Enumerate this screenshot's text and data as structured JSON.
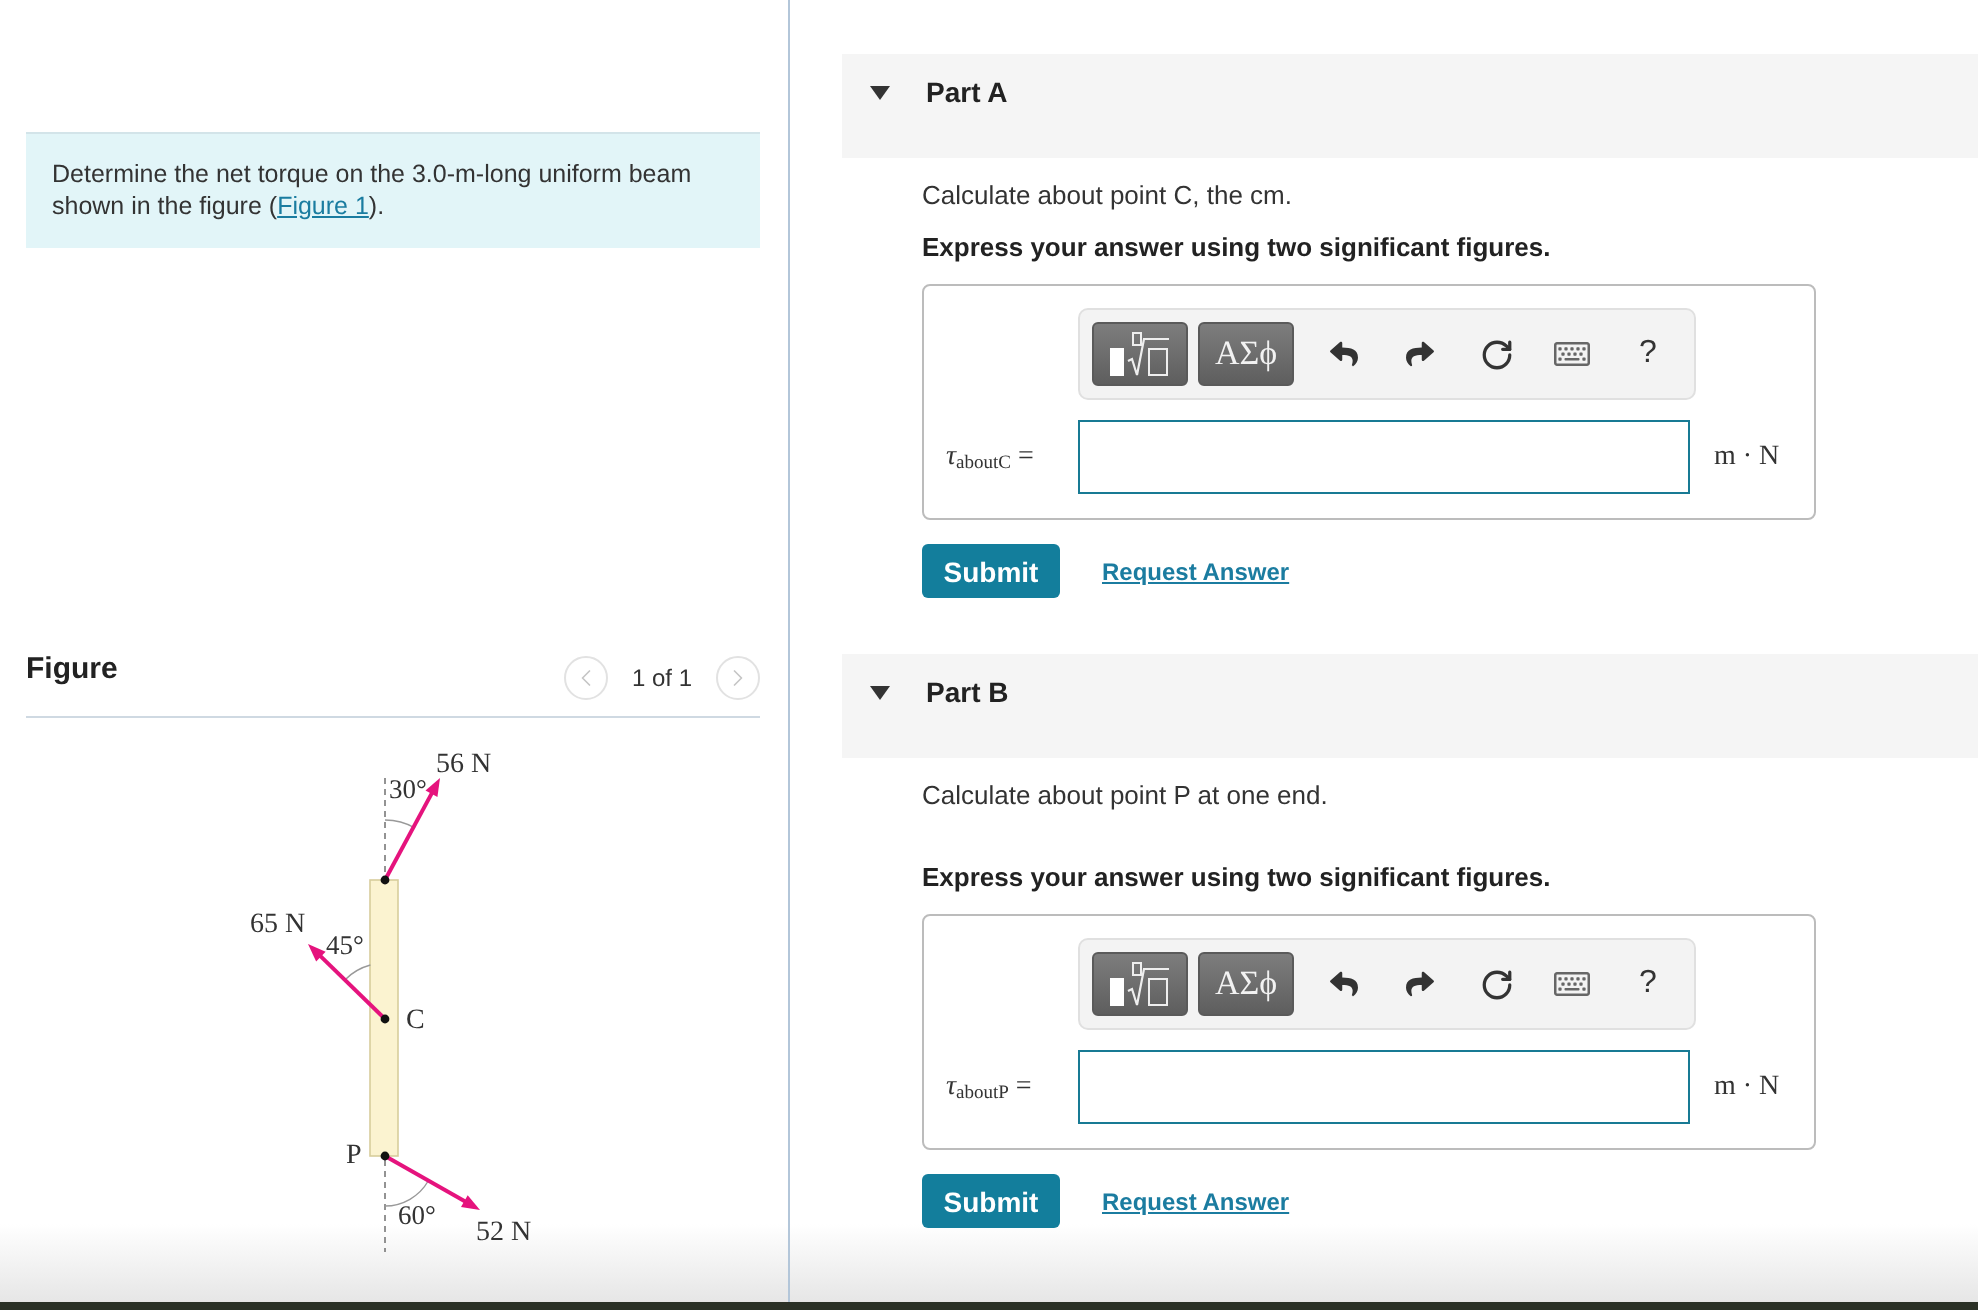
{
  "problem": {
    "text_before": "Determine the net torque on the 3.0-m-long uniform beam shown in the figure (",
    "link": "Figure 1",
    "text_after": ")."
  },
  "figure_panel": {
    "title": "Figure",
    "pager": {
      "label": "1 of 1",
      "prev_disabled": true,
      "next_disabled": true
    },
    "diagram": {
      "forces": [
        {
          "magnitude": "56 N",
          "angle": "30°"
        },
        {
          "magnitude": "65 N",
          "angle": "45°"
        },
        {
          "magnitude": "52 N",
          "angle": "60°"
        }
      ],
      "points": [
        "C",
        "P"
      ]
    }
  },
  "parts": [
    {
      "title": "Part A",
      "expanded": true,
      "prompt": "Calculate about point C, the cm.",
      "instruction": "Express your answer using two significant figures.",
      "toolbar": {
        "symbols": "ΑΣϕ",
        "help": "?"
      },
      "answer": {
        "label": "*τ*$_{aboutC}$ =",
        "unit": "m · N"
      },
      "submit": "Submit",
      "request": "Request Answer"
    },
    {
      "title": "Part B",
      "expanded": true,
      "prompt": "Calculate about point P at one end.",
      "instruction": "Express your answer using two significant figures.",
      "toolbar": {
        "symbols": "ΑΣϕ",
        "help": "?"
      },
      "answer": {
        "label": "*τ*$_{aboutP}$ =",
        "unit": "m · N"
      },
      "submit": "Submit",
      "request": "Request Answer"
    }
  ]
}
